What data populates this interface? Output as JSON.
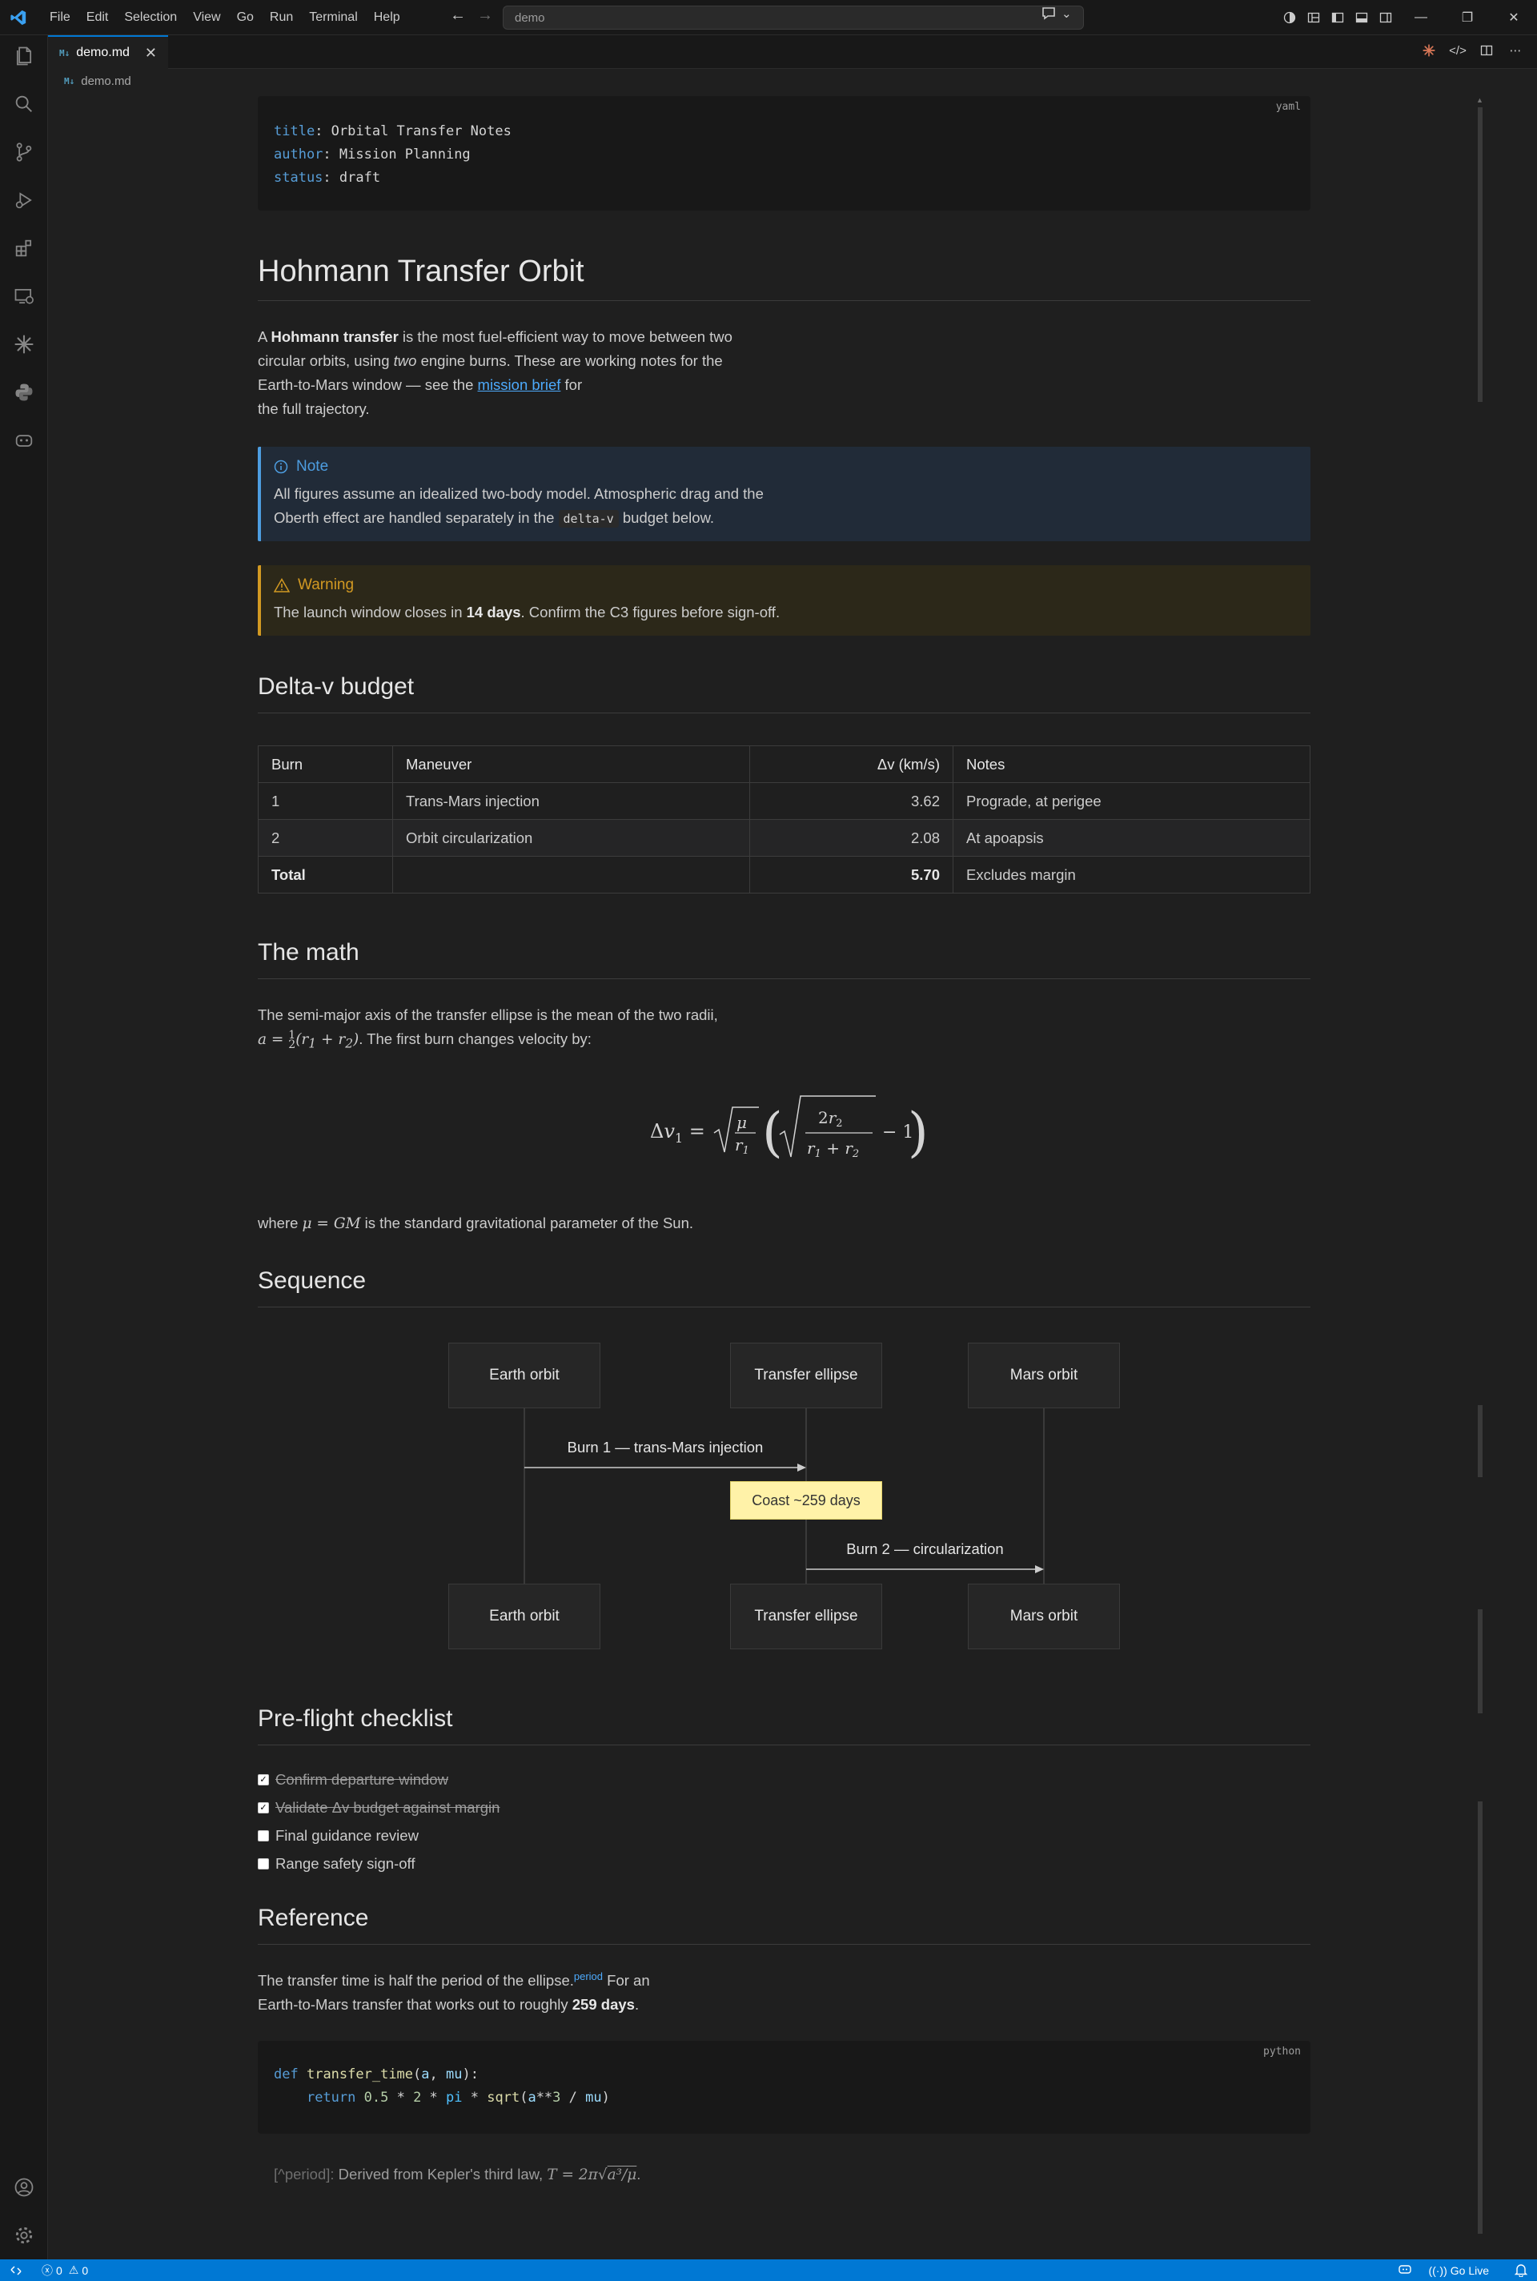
{
  "window": {
    "menu": [
      "File",
      "Edit",
      "Selection",
      "View",
      "Go",
      "Run",
      "Terminal",
      "Help"
    ],
    "search_text": "demo"
  },
  "tab": {
    "label": "demo.md",
    "icon": "M↓"
  },
  "breadcrumb": {
    "label": "demo.md"
  },
  "frontmatter": {
    "lang": "yaml",
    "lines": [
      {
        "key": "title",
        "value": "Orbital Transfer Notes"
      },
      {
        "key": "author",
        "value": "Mission Planning"
      },
      {
        "key": "status",
        "value": "draft"
      }
    ]
  },
  "doc": {
    "title": "Hohmann Transfer Orbit",
    "intro": {
      "p1": "A ",
      "bold": "Hohmann transfer",
      "p2": " is the most fuel-efficient way to move between two",
      "p3": "circular orbits, using ",
      "em": "two",
      "p4": " engine burns. These are working notes for the",
      "p5": "Earth-to-Mars window — see the ",
      "link": "mission brief",
      "p6": " for",
      "p7": "the full trajectory."
    },
    "note": {
      "title": "Note",
      "line1": "All figures assume an idealized two-body model. Atmospheric drag and the",
      "line2a": "Oberth effect are handled separately in the ",
      "code": "delta-v",
      "line2b": " budget below."
    },
    "warning": {
      "title": "Warning",
      "t1": "The launch window closes in ",
      "bold": "14 days",
      "t2": ". Confirm the C3 figures before sign-off."
    },
    "delta_v": {
      "heading": "Delta-v budget",
      "headers": [
        "Burn",
        "Maneuver",
        "Δv (km/s)",
        "Notes"
      ],
      "rows": [
        [
          "1",
          "Trans-Mars injection",
          "3.62",
          "Prograde, at perigee"
        ],
        [
          "2",
          "Orbit circularization",
          "2.08",
          "At apoapsis"
        ]
      ],
      "total": {
        "label": "Total",
        "value": "5.70",
        "note": "Excludes margin"
      }
    },
    "math": {
      "heading": "The math",
      "line1": "The semi-major axis of the transfer ellipse is the mean of the two radii,",
      "line2b": ". The first burn changes velocity by:",
      "where1": "where ",
      "where2": " is the standard gravitational parameter of the Sun."
    },
    "sequence": {
      "heading": "Sequence",
      "participants": [
        "Earth orbit",
        "Transfer ellipse",
        "Mars orbit"
      ],
      "msg1": "Burn 1 — trans-Mars injection",
      "note": "Coast ~259 days",
      "msg2": "Burn 2 — circularization"
    },
    "checklist": {
      "heading": "Pre-flight checklist",
      "items": [
        {
          "label": "Confirm departure window",
          "done": true
        },
        {
          "label": "Validate Δv budget against margin",
          "done": true
        },
        {
          "label": "Final guidance review",
          "done": false
        },
        {
          "label": "Range safety sign-off",
          "done": false
        }
      ]
    },
    "reference": {
      "heading": "Reference",
      "t1": "The transfer time is half the period of the ellipse.",
      "fnref": "period",
      "t2": " For an",
      "t3": "Earth-to-Mars transfer that works out to roughly ",
      "bold": "259 days",
      "t4": ".",
      "code_lang": "python",
      "footnote_label": "[^period]:",
      "footnote_text": " Derived from Kepler's third law, "
    }
  },
  "status": {
    "errors": "0",
    "warnings": "0",
    "go_live": "Go Live"
  },
  "colors": {
    "accent": "#0078d4",
    "link": "#4daafc",
    "note_border": "#4d9de0",
    "warning": "#d29922",
    "note_fill": "#fff2a8"
  }
}
